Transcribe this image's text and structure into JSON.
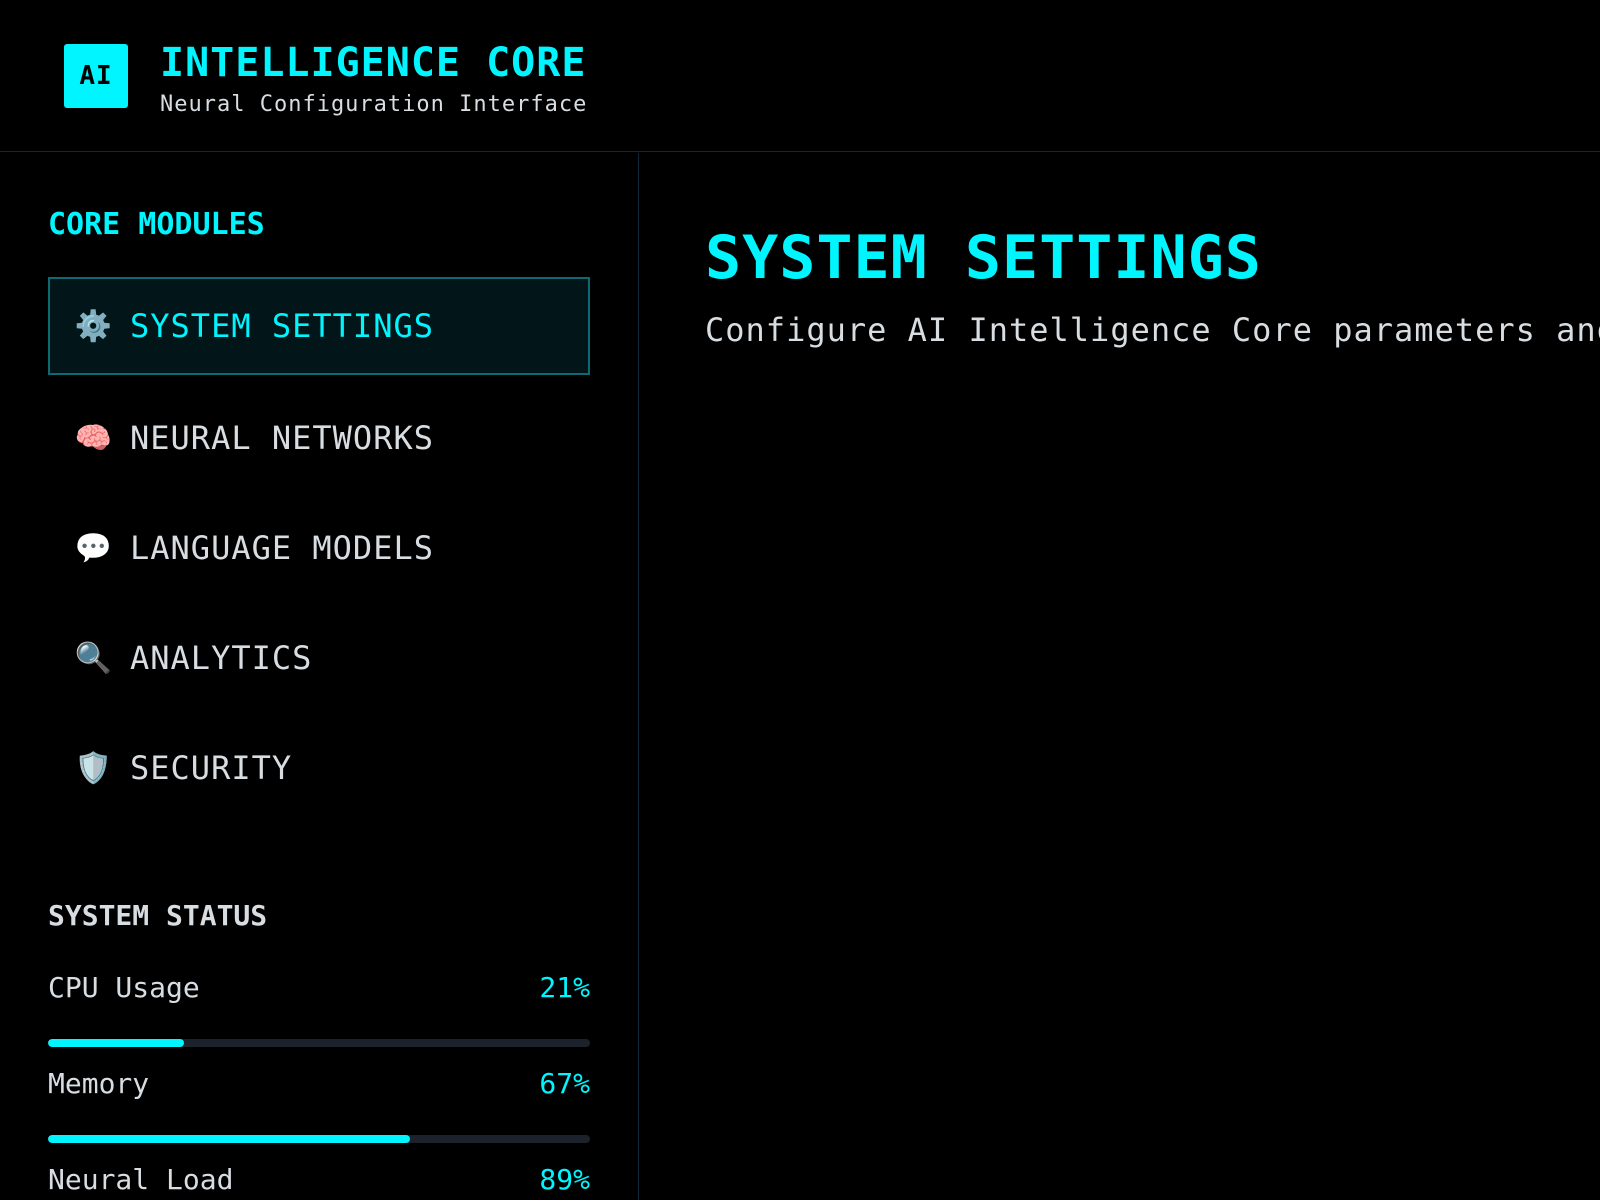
{
  "header": {
    "logo_text": "AI",
    "title": "INTELLIGENCE CORE",
    "subtitle": "Neural Configuration Interface"
  },
  "sidebar": {
    "section_title": "CORE MODULES",
    "items": [
      {
        "icon": "gear-icon",
        "glyph": "⚙️",
        "label": "SYSTEM SETTINGS",
        "active": true
      },
      {
        "icon": "brain-icon",
        "glyph": "🧠",
        "label": "NEURAL NETWORKS",
        "active": false
      },
      {
        "icon": "speech-bubble-icon",
        "glyph": "💬",
        "label": "LANGUAGE MODELS",
        "active": false
      },
      {
        "icon": "magnifier-icon",
        "glyph": "🔍",
        "label": "ANALYTICS",
        "active": false
      },
      {
        "icon": "shield-icon",
        "glyph": "🛡️",
        "label": "SECURITY",
        "active": false
      }
    ],
    "status": {
      "title": "SYSTEM STATUS",
      "metrics": [
        {
          "label": "CPU Usage",
          "value": "21%",
          "fraction": 0.25
        },
        {
          "label": "Memory",
          "value": "67%",
          "fraction": 0.667
        },
        {
          "label": "Neural Load",
          "value": "89%",
          "fraction": 0.89
        }
      ]
    }
  },
  "main": {
    "title": "SYSTEM SETTINGS",
    "description": "Configure AI Intelligence Core parameters and"
  },
  "colors": {
    "accent": "#00f5ff",
    "background": "#000000",
    "text": "#d8dde2",
    "active_bg": "#021619",
    "active_border": "#0b6a72",
    "track": "#1c222b"
  }
}
